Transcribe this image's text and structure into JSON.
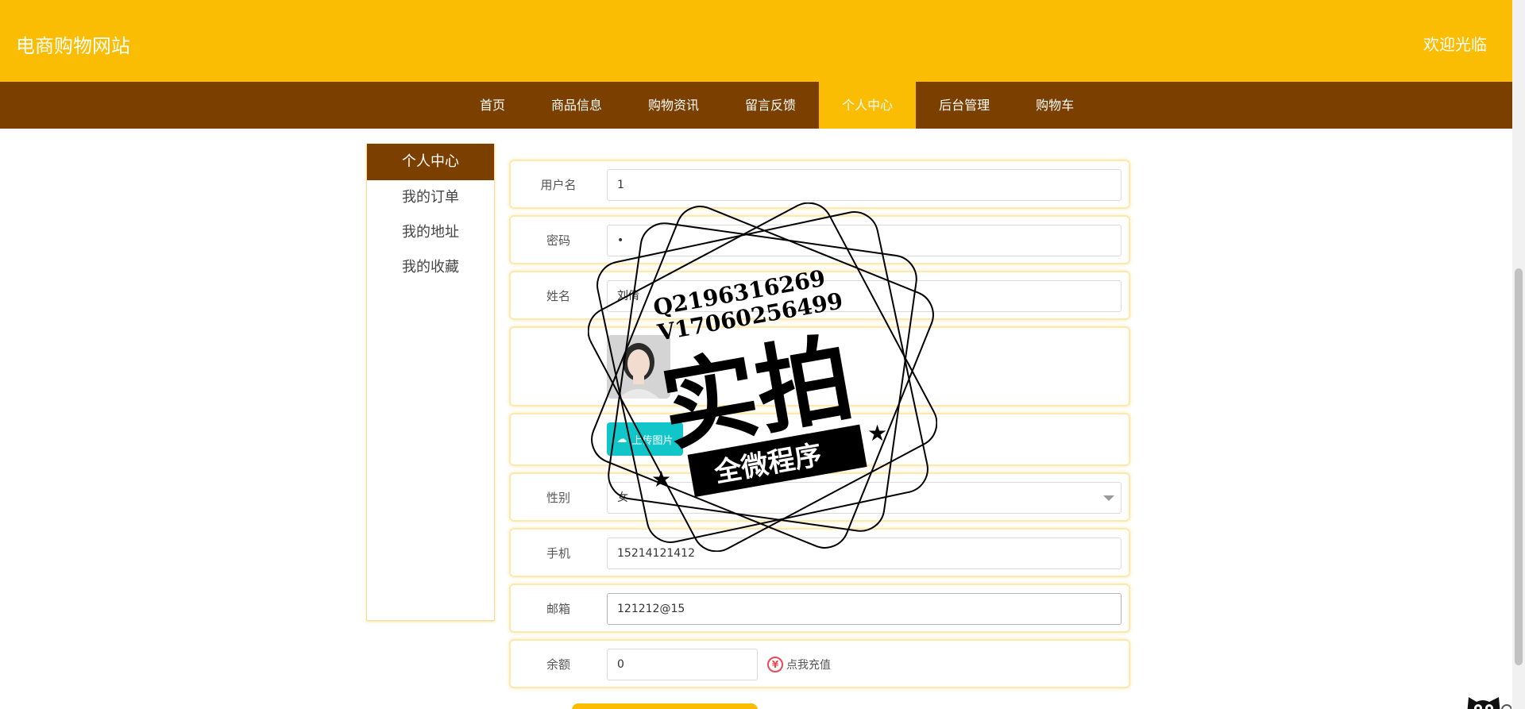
{
  "header": {
    "site_title": "电商购物网站",
    "welcome": "欢迎光临"
  },
  "nav": {
    "items": [
      {
        "label": "首页"
      },
      {
        "label": "商品信息"
      },
      {
        "label": "购物资讯"
      },
      {
        "label": "留言反馈"
      },
      {
        "label": "个人中心"
      },
      {
        "label": "后台管理"
      },
      {
        "label": "购物车"
      }
    ],
    "active": "个人中心"
  },
  "sidebar": {
    "title": "个人中心",
    "items": [
      {
        "label": "我的订单"
      },
      {
        "label": "我的地址"
      },
      {
        "label": "我的收藏"
      }
    ]
  },
  "form": {
    "username": {
      "label": "用户名",
      "value": "1"
    },
    "password": {
      "label": "密码",
      "value": "•"
    },
    "name": {
      "label": "姓名",
      "value": "刘倩"
    },
    "upload": {
      "label": "上传图片"
    },
    "gender": {
      "label": "性别",
      "value": "女"
    },
    "phone": {
      "label": "手机",
      "value": "15214121412"
    },
    "email": {
      "label": "邮箱",
      "value": "121212@15"
    },
    "balance": {
      "label": "余额",
      "value": "0"
    },
    "recharge": {
      "label": "点我充值"
    }
  },
  "watermark": {
    "line1": "Q2196316269",
    "line2": "V17060256499",
    "big": "实拍",
    "banner": "全微程序"
  },
  "colors": {
    "accent": "#fbbd03",
    "nav_bg": "#7b3f00",
    "upload": "#10c6c9"
  }
}
